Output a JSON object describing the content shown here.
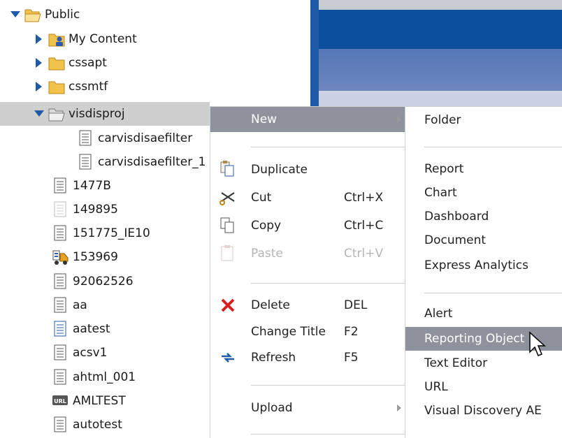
{
  "tree": {
    "items": [
      {
        "label": "Public",
        "icon": "folder-open-icon",
        "caret": "down"
      },
      {
        "label": "My Content",
        "icon": "user-folder-icon",
        "caret": "right"
      },
      {
        "label": "cssapt",
        "icon": "folder-icon",
        "caret": "right"
      },
      {
        "label": "cssmtf",
        "icon": "folder-icon",
        "caret": "right"
      },
      {
        "label": "visdisproj",
        "icon": "folder-open-gray-icon",
        "caret": "down"
      },
      {
        "label": "carvisdisaefilter",
        "icon": "document-icon"
      },
      {
        "label": "carvisdisaefilter_1",
        "icon": "document-icon"
      },
      {
        "label": "1477B",
        "icon": "document-icon"
      },
      {
        "label": "149895",
        "icon": "document-faded-icon"
      },
      {
        "label": "151775_IE10",
        "icon": "document-icon"
      },
      {
        "label": "153969",
        "icon": "truck-icon"
      },
      {
        "label": "92062526",
        "icon": "document-icon"
      },
      {
        "label": "aa",
        "icon": "document-icon"
      },
      {
        "label": "aatest",
        "icon": "document-blue-icon"
      },
      {
        "label": "acsv1",
        "icon": "document-icon"
      },
      {
        "label": "ahtml_001",
        "icon": "document-icon"
      },
      {
        "label": "AMLTEST",
        "icon": "url-icon"
      },
      {
        "label": "autotest",
        "icon": "document-icon"
      }
    ]
  },
  "context_menu": {
    "new": "New",
    "duplicate": "Duplicate",
    "cut": "Cut",
    "cut_sc": "Ctrl+X",
    "copy": "Copy",
    "copy_sc": "Ctrl+C",
    "paste": "Paste",
    "paste_sc": "Ctrl+V",
    "delete": "Delete",
    "delete_sc": "DEL",
    "change_title": "Change Title",
    "change_title_sc": "F2",
    "refresh": "Refresh",
    "refresh_sc": "F5",
    "upload": "Upload"
  },
  "submenu": {
    "folder": "Folder",
    "report": "Report",
    "chart": "Chart",
    "dashboard": "Dashboard",
    "document": "Document",
    "express_analytics": "Express Analytics",
    "alert": "Alert",
    "reporting_object": "Reporting Object",
    "text_editor": "Text Editor",
    "url": "URL",
    "visual_discovery": "Visual Discovery AE"
  },
  "colors": {
    "highlight": "#8d929c",
    "selected_row": "#cfcfcf",
    "caret": "#1f5aa6"
  }
}
